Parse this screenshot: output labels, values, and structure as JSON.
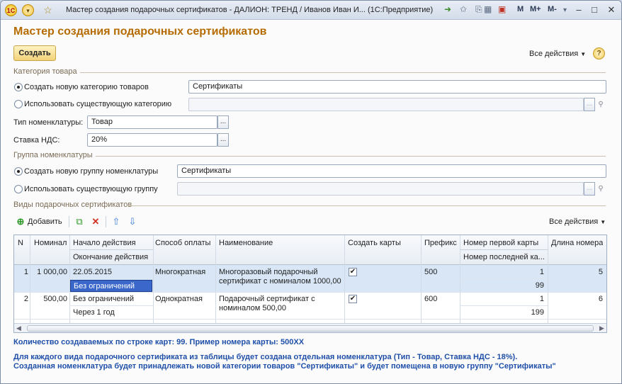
{
  "window": {
    "title": "Мастер создания подарочных сертификатов - ДАЛИОН: ТРЕНД / Иванов Иван И...  (1С:Предприятие)",
    "logo_text": "1С",
    "mem_buttons": [
      "M",
      "M+",
      "M-"
    ]
  },
  "form": {
    "title": "Мастер создания подарочных сертификатов",
    "create_button": "Создать",
    "all_actions": "Все действия",
    "help": "?"
  },
  "category": {
    "group_title": "Категория товара",
    "new_label": "Создать новую категорию товаров",
    "new_value": "Сертификаты",
    "existing_label": "Использовать существующую категорию",
    "existing_value": "",
    "type_label": "Тип номенклатуры:",
    "type_value": "Товар",
    "vat_label": "Ставка НДС:",
    "vat_value": "20%"
  },
  "group": {
    "group_title": "Группа номенклатуры",
    "new_label": "Создать новую группу номенклатуры",
    "new_value": "Сертификаты",
    "existing_label": "Использовать существующую группу",
    "existing_value": ""
  },
  "types": {
    "group_title": "Виды подарочных сертификатов",
    "add_label": "Добавить",
    "all_actions": "Все действия",
    "columns": {
      "n": "N",
      "nominal": "Номинал",
      "start": "Начало действия",
      "end": "Окончание действия",
      "payment": "Способ оплаты",
      "name": "Наименование",
      "create_cards": "Создать карты",
      "prefix": "Префикс",
      "first_card": "Номер первой карты",
      "last_card": "Номер последней ка...",
      "length": "Длина номера"
    },
    "rows": [
      {
        "n": "1",
        "nominal": "1 000,00",
        "start": "22.05.2015",
        "end": "Без ограничений",
        "payment": "Многократная",
        "name1": "Многоразовый подарочный",
        "name2": "сертификат с номиналом 1000,00",
        "create_cards": true,
        "prefix": "500",
        "first_card": "1",
        "last_card": "99",
        "length": "5"
      },
      {
        "n": "2",
        "nominal": "500,00",
        "start": "Без ограничений",
        "end": "Через 1 год",
        "payment": "Однократная",
        "name1": "Подарочный сертификат с",
        "name2": "номиналом 500,00",
        "create_cards": true,
        "prefix": "600",
        "first_card": "1",
        "last_card": "199",
        "length": "6"
      }
    ]
  },
  "info": {
    "line1": "Количество создаваемых по строке карт: 99. Пример номера карты: 500XX",
    "line2": "Для каждого вида подарочного сертификата из таблицы будет создана отдельная номенклатура (Тип - Товар, Ставка НДС - 18%).",
    "line3": "Созданная номенклатура будет принадлежать новой категории товаров \"Сертификаты\" и будет помещена в новую группу \"Сертификаты\""
  },
  "colors": {
    "title": "#b56b00",
    "info": "#1f4fa8",
    "selected_row": "#d8e6f6",
    "current_cell": "#3a67c9"
  }
}
